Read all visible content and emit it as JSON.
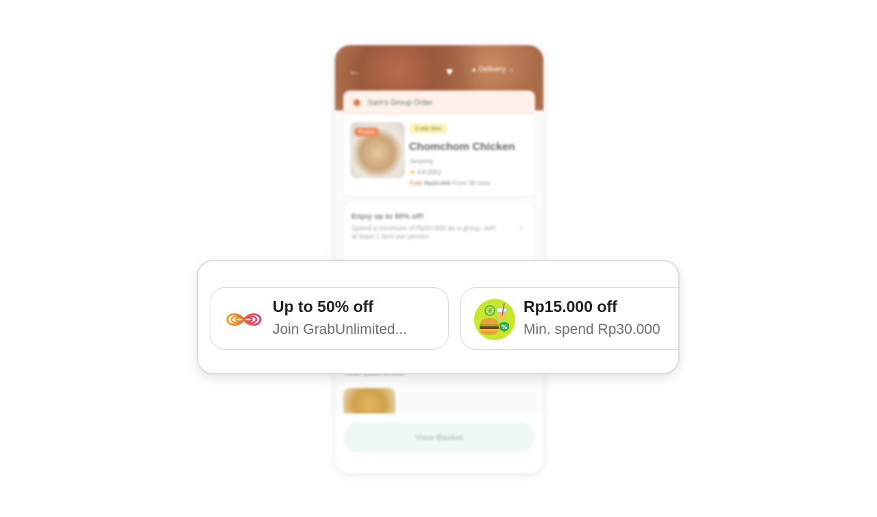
{
  "background_app": {
    "header": {
      "delivery_label": "Delivery",
      "back_icon": "arrow-left-icon",
      "favorite_icon": "heart-icon"
    },
    "group_order": {
      "label": "Sam's Group Order",
      "icon": "group-order-icon"
    },
    "restaurant": {
      "photo_tag": "Promo",
      "badge": "5-star item",
      "name": "Chomchom Chicken",
      "area": "Serpong",
      "rating": "4.8",
      "reviews": "(581)",
      "delivery_fee_new": "Free",
      "delivery_fee_old": "Rp10.000",
      "delivery_time": "From 36 mins"
    },
    "promo_banner": {
      "title": "Enjoy up to 50% off!",
      "description": "Spend a minimum of Rp50.000 as a group, with at least 1 item per person."
    },
    "last_order_label": "Your Last Order",
    "basket_button": "View Basket"
  },
  "offers": [
    {
      "title": "Up to 50% off",
      "subtitle": "Join GrabUnlimited...",
      "icon": "grab-unlimited-infinity-icon"
    },
    {
      "title": "Rp15.000 off",
      "subtitle": "Min. spend Rp30.000",
      "icon": "food-discount-icon"
    }
  ],
  "colors": {
    "offer_title": "#1f1f1f",
    "offer_subtitle": "#6e6e6e",
    "card_border": "#d8d8d8",
    "infinity_gradient_start": "#f0a020",
    "infinity_gradient_end": "#e03a78",
    "discount_icon_bg": "#c8e62a",
    "discount_badge": "#2fa84f"
  }
}
